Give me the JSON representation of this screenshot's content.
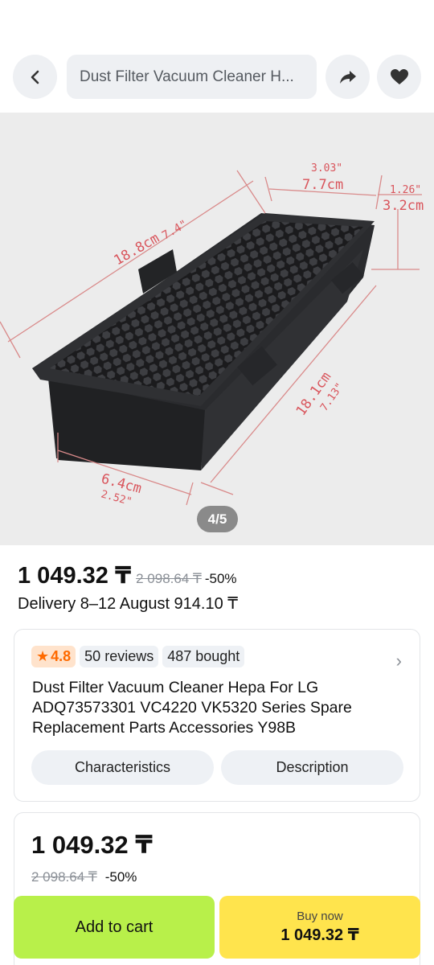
{
  "header": {
    "search_text": "Dust Filter Vacuum Cleaner H...",
    "back_icon": "chevron-left-icon",
    "share_icon": "share-arrow-icon",
    "favorite_icon": "heart-icon"
  },
  "gallery": {
    "counter": "4/5",
    "dimensions": {
      "top_width_in": "3.03\"",
      "top_width_cm": "7.7cm",
      "height_in": "1.26\"",
      "height_cm": "3.2cm",
      "length_cm": "18.8cm",
      "length_in": "7.4\"",
      "depth_cm": "18.1cm",
      "depth_in": "7.13\"",
      "base_cm": "6.4cm",
      "base_in": "2.52\""
    }
  },
  "pricing": {
    "price": "1 049.32 ₸",
    "old_price": "2 098.64 ₸",
    "discount": "-50%",
    "delivery": "Delivery 8–12 August 914.10 ₸"
  },
  "product": {
    "rating": "4.8",
    "reviews": "50 reviews",
    "bought": "487 bought",
    "title": "Dust Filter Vacuum Cleaner Hepa For LG ADQ73573301 VC4220 VK5320 Series Spare Replacement Parts Accessories Y98B",
    "characteristics_label": "Characteristics",
    "description_label": "Description"
  },
  "offer": {
    "price": "1 049.32 ₸",
    "old_price": "2 098.64 ₸",
    "discount": "-50%"
  },
  "actions": {
    "add_to_cart": "Add to cart",
    "buy_now": "Buy now",
    "buy_now_price": "1 049.32 ₸"
  },
  "colors": {
    "cart_button": "#b8f04a",
    "buy_button": "#ffe44d",
    "rating_accent": "#ff6a00"
  }
}
